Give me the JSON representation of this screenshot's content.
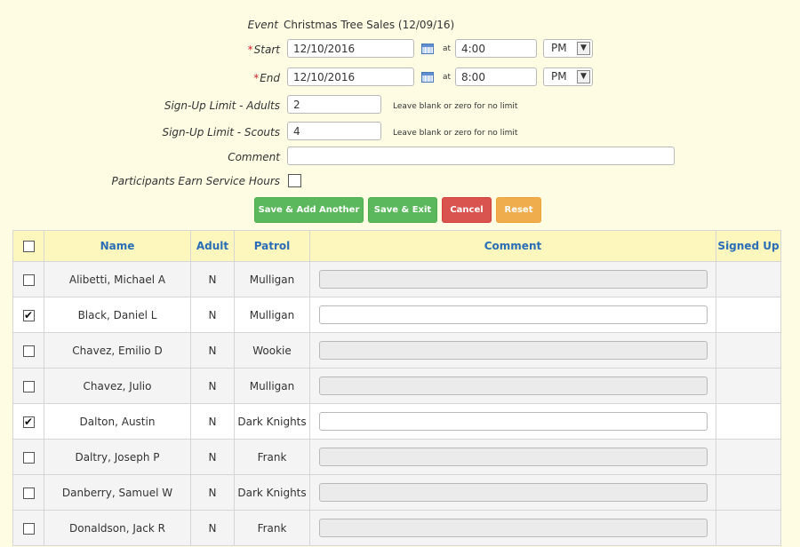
{
  "event": {
    "label": "Event",
    "value": "Christmas Tree Sales (12/09/16)"
  },
  "start": {
    "label": "Start",
    "required_mark": "*",
    "date": "12/10/2016",
    "at": "at",
    "time": "4:00",
    "ampm": "PM"
  },
  "end": {
    "label": "End",
    "required_mark": "*",
    "date": "12/10/2016",
    "at": "at",
    "time": "8:00",
    "ampm": "PM"
  },
  "limit_adults": {
    "label": "Sign-Up Limit - Adults",
    "value": "2",
    "hint": "Leave blank or zero for no limit"
  },
  "limit_scouts": {
    "label": "Sign-Up Limit - Scouts",
    "value": "4",
    "hint": "Leave blank or zero for no limit"
  },
  "comment": {
    "label": "Comment",
    "value": ""
  },
  "service_hours": {
    "label": "Participants Earn Service Hours",
    "checked": false
  },
  "buttons": {
    "save_add": "Save & Add Another",
    "save_exit": "Save & Exit",
    "cancel": "Cancel",
    "reset": "Reset"
  },
  "colors": {
    "green": "#5cb85c",
    "red": "#d9534f",
    "orange": "#f0ad4e",
    "header_text": "#2a6db7",
    "header_bg": "#fdf7bd"
  },
  "table": {
    "headers": {
      "name": "Name",
      "adult": "Adult",
      "patrol": "Patrol",
      "comment": "Comment",
      "signed_up": "Signed Up"
    },
    "rows": [
      {
        "checked": false,
        "name": "Alibetti, Michael A",
        "adult": "N",
        "patrol": "Mulligan",
        "signed_up": ""
      },
      {
        "checked": true,
        "name": "Black, Daniel L",
        "adult": "N",
        "patrol": "Mulligan",
        "signed_up": ""
      },
      {
        "checked": false,
        "name": "Chavez, Emilio D",
        "adult": "N",
        "patrol": "Wookie",
        "signed_up": ""
      },
      {
        "checked": false,
        "name": "Chavez, Julio",
        "adult": "N",
        "patrol": "Mulligan",
        "signed_up": ""
      },
      {
        "checked": true,
        "name": "Dalton, Austin",
        "adult": "N",
        "patrol": "Dark Knights",
        "signed_up": ""
      },
      {
        "checked": false,
        "name": "Daltry, Joseph P",
        "adult": "N",
        "patrol": "Frank",
        "signed_up": ""
      },
      {
        "checked": false,
        "name": "Danberry, Samuel W",
        "adult": "N",
        "patrol": "Dark Knights",
        "signed_up": ""
      },
      {
        "checked": false,
        "name": "Donaldson, Jack R",
        "adult": "N",
        "patrol": "Frank",
        "signed_up": ""
      }
    ]
  }
}
